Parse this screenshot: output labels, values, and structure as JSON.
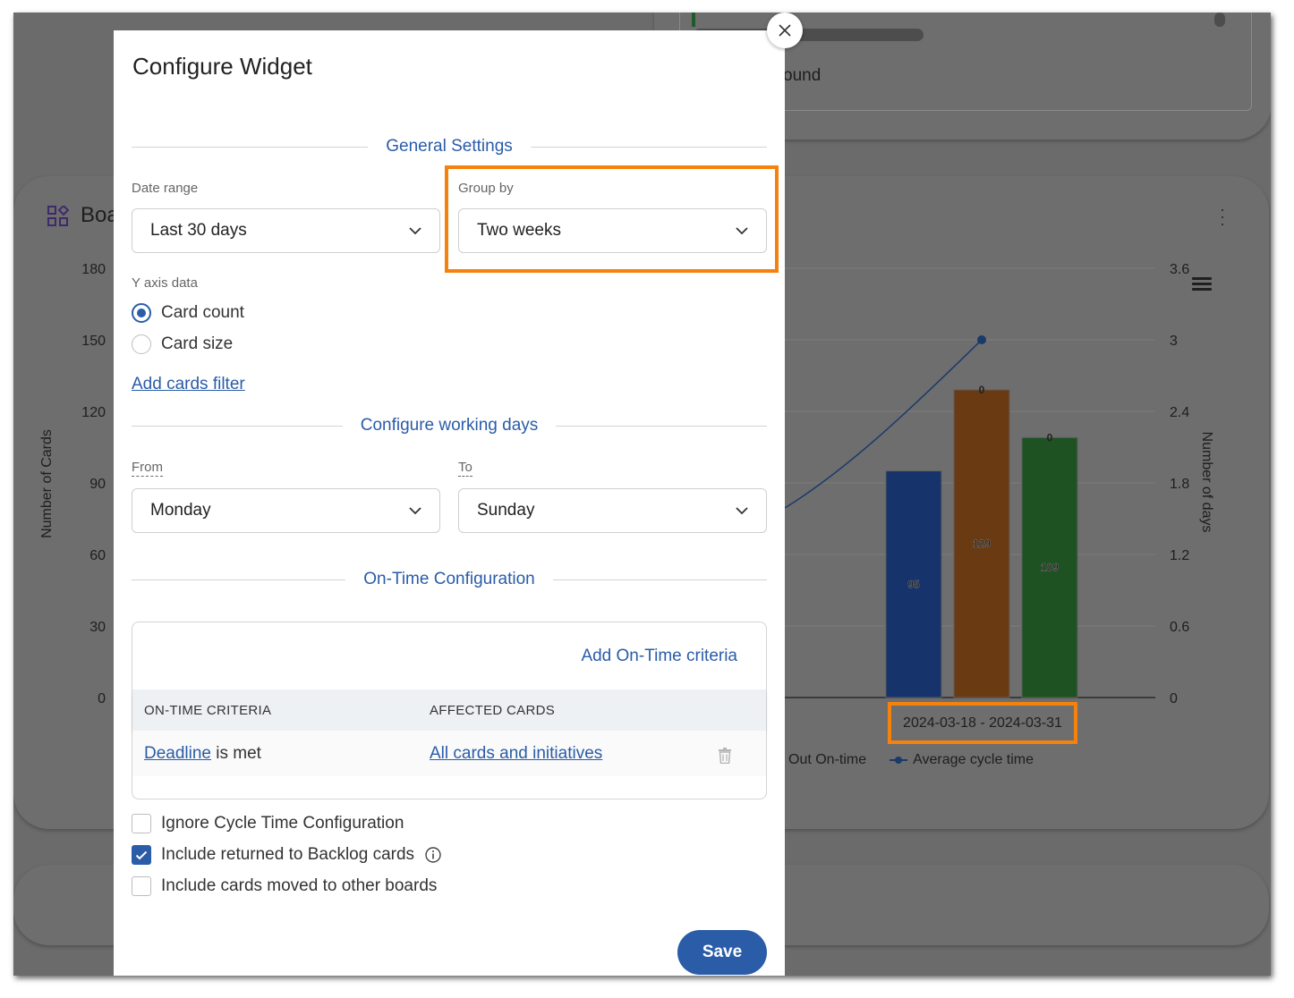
{
  "background": {
    "top_card_text": "ound",
    "board_title": "Boa",
    "chart_data": {
      "type": "bar",
      "categories": [
        "2024-03-18 - 2024-03-31"
      ],
      "series": [
        {
          "values": [
            95
          ],
          "label": "95",
          "top_label": "",
          "color": "#16336b"
        },
        {
          "values": [
            129
          ],
          "label": "129",
          "top_label": "0",
          "color": "#6a3a12"
        },
        {
          "values": [
            109
          ],
          "label": "109",
          "top_label": "0",
          "color": "#1f5222"
        }
      ],
      "line": {
        "name": "Average cycle time",
        "point_value": 3.0,
        "axis": "right"
      },
      "y_left": {
        "label": "Number of Cards",
        "ticks": [
          "180",
          "150",
          "120",
          "90",
          "60",
          "30",
          "0"
        ],
        "min": 0,
        "max": 180
      },
      "y_right": {
        "label": "Number of days",
        "ticks": [
          "3.6",
          "3",
          "2.4",
          "1.8",
          "1.2",
          "0.6",
          "0"
        ],
        "min": 0,
        "max": 3.6
      },
      "legend": {
        "partial_item": "Out On-time",
        "line_item": "Average cycle time"
      },
      "highlight_color": "#f5820c"
    }
  },
  "modal": {
    "title": "Configure Widget",
    "general_settings": "General Settings",
    "date_range_label": "Date range",
    "date_range_value": "Last 30 days",
    "group_by_label": "Group by",
    "group_by_value": "Two weeks",
    "y_axis_label": "Y axis data",
    "y_options": [
      {
        "label": "Card count",
        "selected": true
      },
      {
        "label": "Card size",
        "selected": false
      }
    ],
    "add_filter": "Add cards filter",
    "working_days_title": "Configure working days",
    "from_label": "From",
    "from_value": "Monday",
    "to_label": "To",
    "to_value": "Sunday",
    "ontime_title": "On-Time Configuration",
    "add_criteria": "Add On-Time criteria",
    "col_criteria": "ON-TIME CRITERIA",
    "col_affected": "AFFECTED CARDS",
    "row_criteria_link": "Deadline",
    "row_criteria_rest": " is met",
    "row_affected": "All cards and initiatives",
    "options": [
      {
        "label": "Ignore Cycle Time Configuration",
        "checked": false
      },
      {
        "label": "Include returned to Backlog cards",
        "checked": true
      },
      {
        "label": "Include cards moved to other boards",
        "checked": false
      }
    ],
    "save": "Save",
    "accent": "#2a5ca8"
  }
}
